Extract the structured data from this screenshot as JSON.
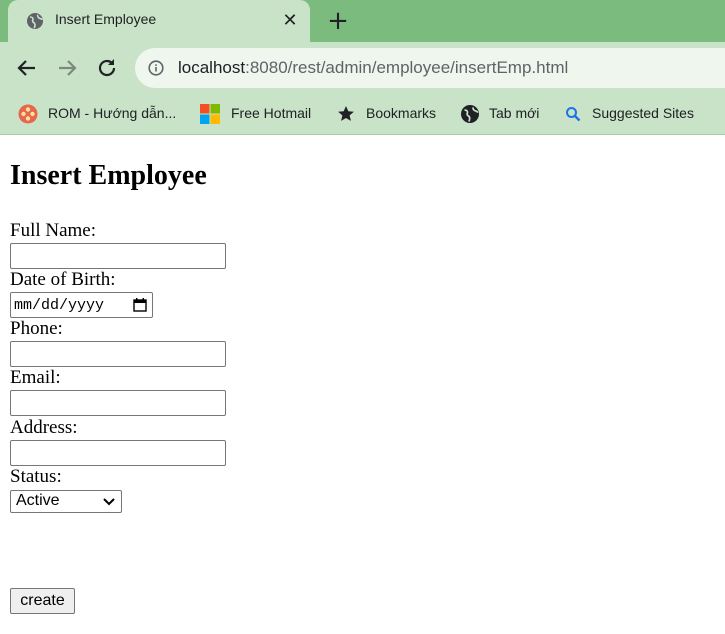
{
  "browser": {
    "tab": {
      "title": "Insert Employee",
      "icon": "globe-icon",
      "close_glyph": "✕"
    },
    "new_tab_glyph": "+",
    "address": {
      "host": "localhost",
      "path": ":8080/rest/admin/employee/insertEmp.html"
    },
    "bookmarks": [
      {
        "label": "ROM - Hướng dẫn...",
        "icon": "rom-icon"
      },
      {
        "label": "Free Hotmail",
        "icon": "windows-icon"
      },
      {
        "label": "Bookmarks",
        "icon": "star-icon"
      },
      {
        "label": "Tab mới",
        "icon": "globe-icon"
      },
      {
        "label": "Suggested Sites",
        "icon": "search-icon"
      }
    ],
    "colors": {
      "tab_strip": "#7cbb7e",
      "toolbar": "#c8e3c8"
    }
  },
  "page": {
    "title": "Insert Employee",
    "fields": {
      "full_name": {
        "label": "Full Name:",
        "value": ""
      },
      "dob": {
        "label": "Date of Birth:",
        "placeholder": "mm/dd/yyyy"
      },
      "phone": {
        "label": "Phone:",
        "value": ""
      },
      "email": {
        "label": "Email:",
        "value": ""
      },
      "address": {
        "label": "Address:",
        "value": ""
      },
      "status": {
        "label": "Status:",
        "selected": "Active"
      }
    },
    "submit_label": "create"
  }
}
